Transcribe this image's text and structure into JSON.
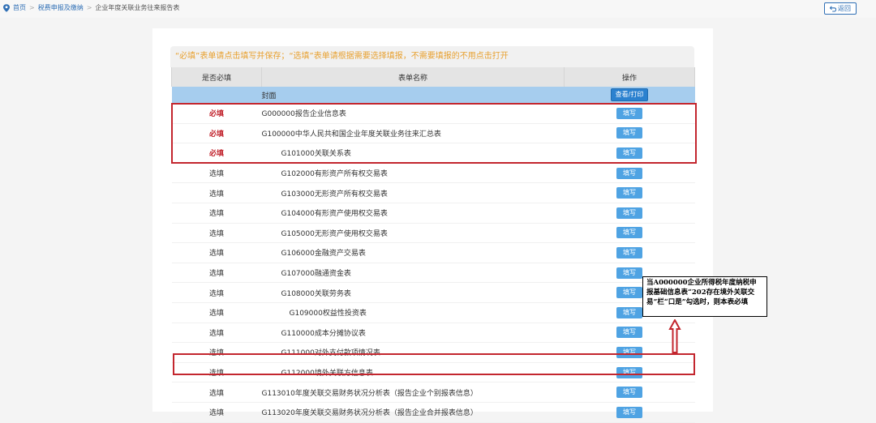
{
  "breadcrumb": {
    "home": "首页",
    "level1": "税费申报及缴纳",
    "current": "企业年度关联业务往来报告表"
  },
  "back_button": "返回",
  "notice": "“必填”表单请点击填写并保存；“选填”表单请根据需要选择填报，不需要填报的不用点击打开",
  "table": {
    "headers": [
      "是否必填",
      "表单名称",
      "操作"
    ],
    "cover": {
      "name": "封面",
      "action": "查看/打印"
    },
    "rows": [
      {
        "req": "必填",
        "name": "G000000报告企业信息表",
        "action": "填写"
      },
      {
        "req": "必填",
        "name": "G100000中华人民共和国企业年度关联业务往来汇总表",
        "action": "填写"
      },
      {
        "req": "必填",
        "name": "G101000关联关系表",
        "action": "填写"
      },
      {
        "req": "选填",
        "name": "G102000有形资产所有权交易表",
        "action": "填写"
      },
      {
        "req": "选填",
        "name": "G103000无形资产所有权交易表",
        "action": "填写"
      },
      {
        "req": "选填",
        "name": "G104000有形资产使用权交易表",
        "action": "填写"
      },
      {
        "req": "选填",
        "name": "G105000无形资产使用权交易表",
        "action": "填写"
      },
      {
        "req": "选填",
        "name": "G106000金融资产交易表",
        "action": "填写"
      },
      {
        "req": "选填",
        "name": "G107000融通资金表",
        "action": "填写"
      },
      {
        "req": "选填",
        "name": "G108000关联劳务表",
        "action": "填写"
      },
      {
        "req": "选填",
        "name": "G109000权益性投资表",
        "action": "填写"
      },
      {
        "req": "选填",
        "name": "G110000成本分摊协议表",
        "action": "填写"
      },
      {
        "req": "选填",
        "name": "G111000对外支付款项情况表",
        "action": "填写"
      },
      {
        "req": "选填",
        "name": "G112000境外关联方信息表",
        "action": "填写"
      },
      {
        "req": "选填",
        "name": "G113010年度关联交易财务状况分析表（报告企业个别报表信息）",
        "action": "填写"
      },
      {
        "req": "选填",
        "name": "G113020年度关联交易财务状况分析表（报告企业合并报表信息）",
        "action": "填写"
      }
    ]
  },
  "annotation": "当A000000企业所得税年度纳税申报基础信息表“202存在境外关联交易”栏“口是”勾选时，则本表必填",
  "colors": {
    "required": "#c0202a",
    "notice": "#e8a131",
    "button": "#4fa3e3",
    "highlight": "#c3262e",
    "cover_row": "#a6cdee"
  }
}
